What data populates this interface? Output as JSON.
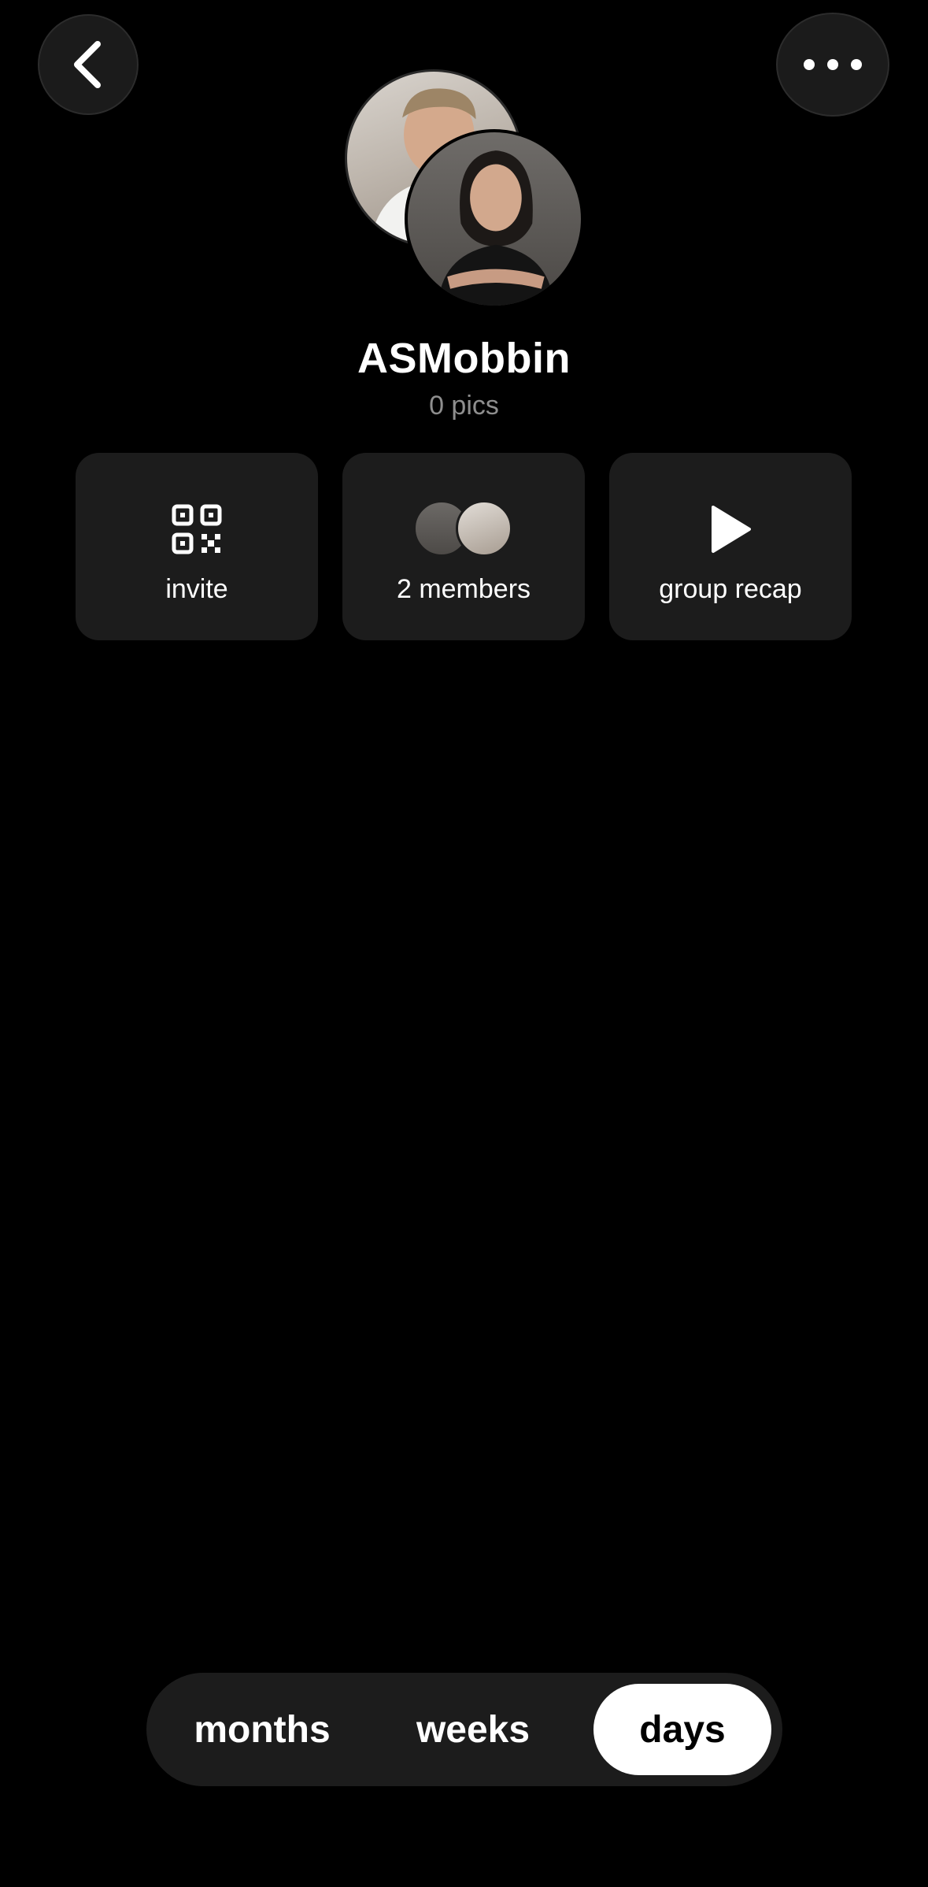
{
  "header": {
    "back_icon": "chevron-left-icon",
    "more_icon": "ellipsis-icon"
  },
  "group": {
    "name": "ASMobbin",
    "pics_count": "0 pics"
  },
  "actions": {
    "invite_label": "invite",
    "invite_icon": "qr-code-icon",
    "members_label": "2 members",
    "recap_label": "group recap",
    "recap_icon": "play-icon"
  },
  "view_toggle": {
    "months": "months",
    "weeks": "weeks",
    "days": "days",
    "selected": "days"
  },
  "colors": {
    "background": "#000000",
    "card": "#1c1c1c",
    "accent_selected": "#ffffff",
    "muted_text": "#8e8e8e"
  }
}
